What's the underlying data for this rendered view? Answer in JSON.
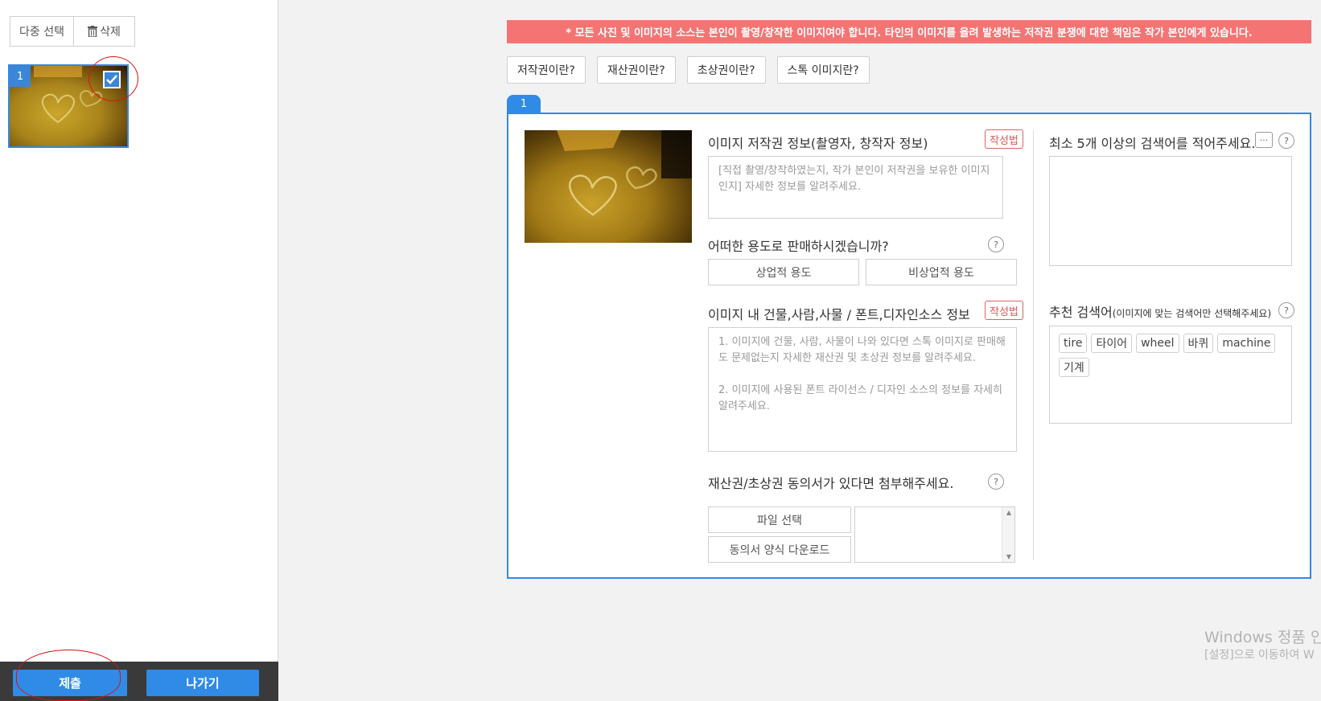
{
  "sidebar": {
    "multi_select_label": "다중 선택",
    "delete_label": "삭제",
    "thumbnail": {
      "number": "1",
      "checked": true
    },
    "submit_label": "제출",
    "exit_label": "나가기"
  },
  "main": {
    "warning": "* 모든 사진 및 이미지의 소스는 본인이 촬영/창작한 이미지여야 합니다. 타인의 이미지를 올려 발생하는 저작권 분쟁에 대한 책임은 작가 본인에게 있습니다.",
    "info_buttons": [
      "저작권이란?",
      "재산권이란?",
      "초상권이란?",
      "스톡 이미지란?"
    ],
    "card_number": "1",
    "copyright": {
      "title": "이미지 저작권 정보(촬영자, 창작자 정보)",
      "badge": "작성법",
      "placeholder": "[직접 촬영/창작하였는지, 작가 본인이 저작권을 보유한 이미지인지] 자세한 정보를 알려주세요."
    },
    "usage": {
      "title": "어떠한 용도로 판매하시겠습니까?",
      "help": "?",
      "commercial": "상업적 용도",
      "noncommercial": "비상업적 용도"
    },
    "sources": {
      "title": "이미지 내 건물,사람,사물 / 폰트,디자인소스 정보",
      "badge": "작성법",
      "placeholder": "1. 이미지에 건물, 사람, 사물이 나와 있다면 스톡 이미지로 판매해도 문제없는지 자세한 재산권 및 초상권 정보를 알려주세요.\n\n2. 이미지에 사용된 폰트 라이선스 / 디자인 소스의 정보를 자세히 알려주세요."
    },
    "consent": {
      "title": "재산권/초상권 동의서가 있다면 첨부해주세요.",
      "help": "?",
      "file_select": "파일 선택",
      "form_download": "동의서 양식 다운로드"
    },
    "keywords": {
      "title": "최소 5개 이상의 검색어를 적어주세요.",
      "more": "···",
      "help": "?"
    },
    "recommended": {
      "title": "추천 검색어",
      "subtitle": "(이미지에 맞는 검색어만 선택해주세요)",
      "help": "?",
      "tags": [
        "tire",
        "타이어",
        "wheel",
        "바퀴",
        "machine",
        "기계"
      ]
    }
  },
  "watermark": {
    "line1": "Windows 정품 인",
    "line2": "[설정]으로 이동하여 W"
  },
  "colors": {
    "accent": "#2f8be6",
    "warning_bg": "#f47474",
    "badge_red": "#e05555",
    "bottom_bar": "#3a3a3a"
  }
}
